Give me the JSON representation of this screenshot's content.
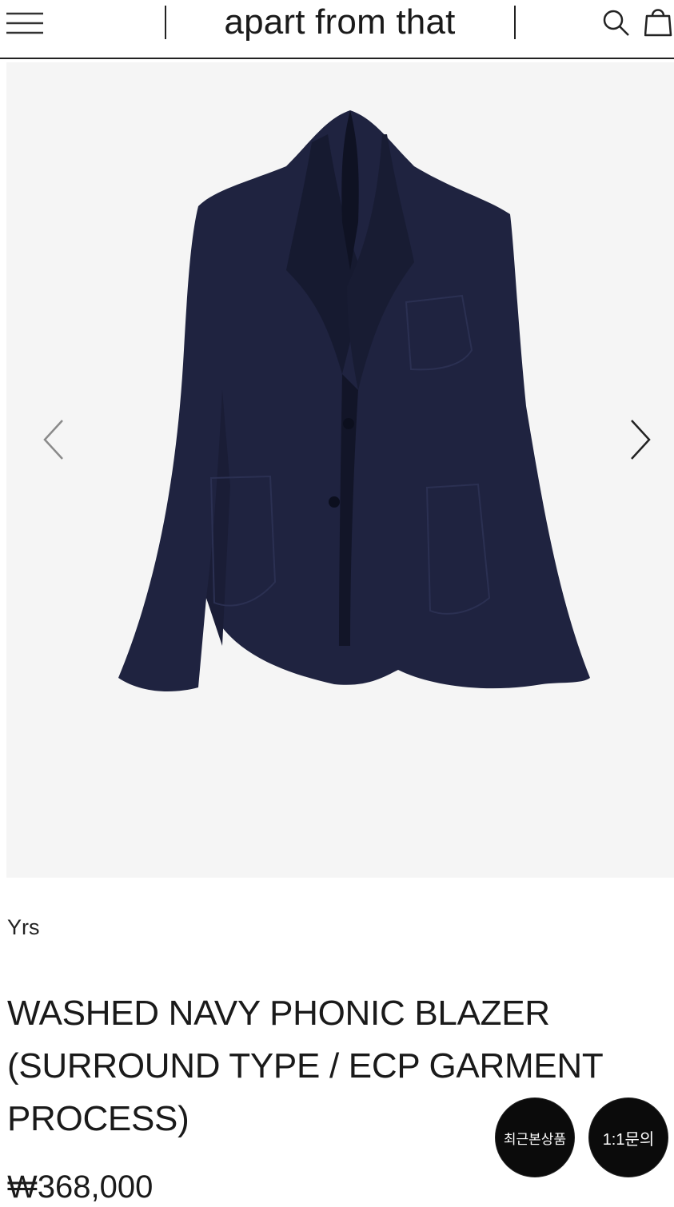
{
  "header": {
    "brand": "apart from that",
    "icons": {
      "menu": "hamburger-menu-icon",
      "search": "search-icon",
      "bag": "shopping-bag-icon"
    }
  },
  "gallery": {
    "image": "navy-blazer-product-photo",
    "prev_icon": "chevron-left-icon",
    "next_icon": "chevron-right-icon",
    "background": "#f5f5f5",
    "product_color": "#1f2340"
  },
  "product": {
    "brand": "Yrs",
    "title": "WASHED NAVY PHONIC BLAZER (SURROUND TYPE / ECP GARMENT PROCESS)",
    "price": "₩368,000"
  },
  "floating": {
    "recent_label": "최근본상품",
    "inquiry_label": "1:1문의"
  }
}
